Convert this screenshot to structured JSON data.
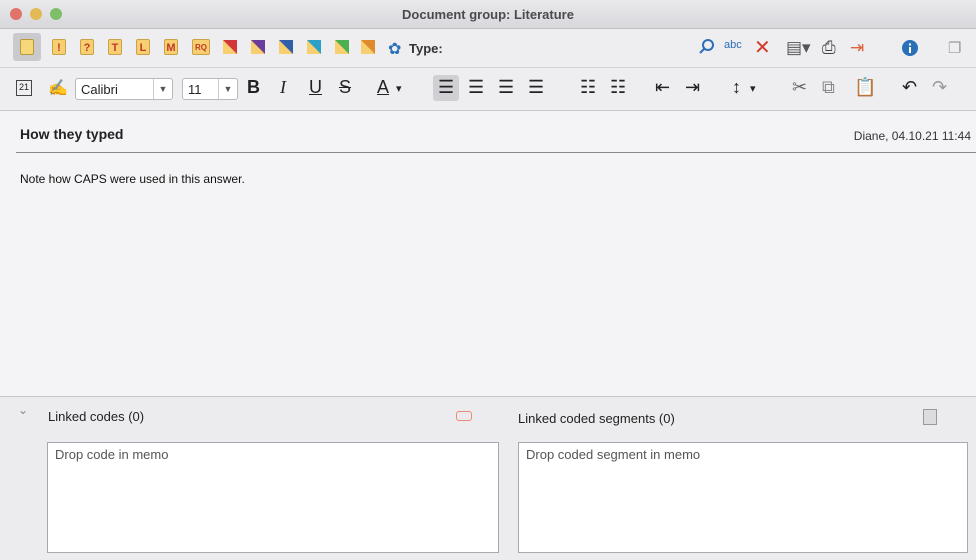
{
  "window": {
    "title": "Document group: Literature"
  },
  "toolbar1": {
    "memo_letters": [
      "!",
      "?",
      "T",
      "L",
      "M",
      "RQ"
    ],
    "type_label": "Type:",
    "icons": [
      "search-icon",
      "spellcheck-icon",
      "delete-icon",
      "export-icon",
      "print-icon",
      "exit-icon",
      "info-icon",
      "undock-icon"
    ]
  },
  "format_toolbar": {
    "calendar_text": "21",
    "font": "Calibri",
    "size": "11",
    "bold": "B",
    "italic": "I",
    "underline": "U",
    "strike": "S",
    "color": "A"
  },
  "memo": {
    "title": "How they typed",
    "meta": "Diane, 04.10.21 11:44",
    "body": "Note how CAPS were used in this answer."
  },
  "linked": {
    "codes_label": "Linked codes (0)",
    "segments_label": "Linked coded segments (0)",
    "codes_placeholder": "Drop code in memo",
    "segments_placeholder": "Drop coded segment in memo"
  },
  "colors": {
    "accent": "#2a6fb8",
    "memo_yellow": "#f7cf70",
    "memo_red": "#c0392b"
  }
}
